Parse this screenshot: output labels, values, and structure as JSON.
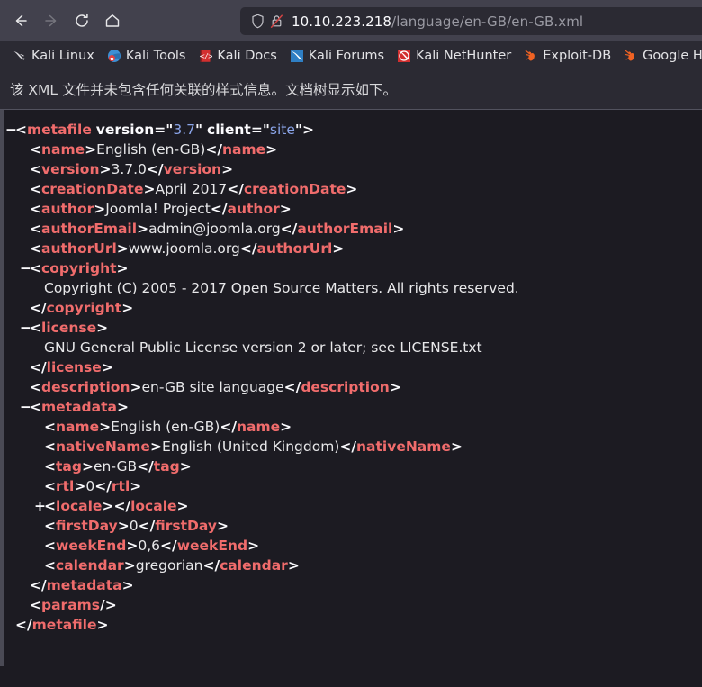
{
  "browser": {
    "nav": {
      "back": {
        "name": "back-button",
        "enabled": true,
        "title": "Back"
      },
      "forward": {
        "name": "forward-button",
        "enabled": false,
        "title": "Forward"
      },
      "reload": {
        "name": "reload-button",
        "enabled": true,
        "title": "Reload"
      },
      "home": {
        "name": "home-button",
        "enabled": true,
        "title": "Home"
      }
    },
    "urlbar": {
      "shield_icon": "shield-icon",
      "lock_icon": "lock-crossed-out-icon",
      "host": "10.10.223.218",
      "path": "/language/en-GB/en-GB.xml",
      "full_url": "10.10.223.218/language/en-GB/en-GB.xml"
    },
    "bookmarks": [
      {
        "label": "Kali Linux",
        "icon": "kali-dragon-icon"
      },
      {
        "label": "Kali Tools",
        "icon": "kali-tools-icon"
      },
      {
        "label": "Kali Docs",
        "icon": "kali-docs-book-icon"
      },
      {
        "label": "Kali Forums",
        "icon": "kali-forums-icon"
      },
      {
        "label": "Kali NetHunter",
        "icon": "kali-nethunter-icon"
      },
      {
        "label": "Exploit-DB",
        "icon": "exploit-db-icon"
      },
      {
        "label": "Google Hacking D",
        "icon": "google-hacking-db-icon"
      }
    ]
  },
  "notice": {
    "text": "该 XML 文件并未包含任何关联的样式信息。文档树显示如下。"
  },
  "colors": {
    "chrome_bg": "#42414d",
    "bookmark_bg": "#2b2a33",
    "page_bg": "#1c1b22",
    "tag": "#f06c6c",
    "attr_value": "#8aa4e8",
    "text": "#e8e8ea",
    "punctuation": "#fbfbfe"
  },
  "xml": {
    "lines": [
      {
        "twisty": "-",
        "indent": 0,
        "parts": [
          {
            "t": "punc",
            "v": "<"
          },
          {
            "t": "tag",
            "v": "metafile"
          },
          {
            "t": "txt",
            "v": " "
          },
          {
            "t": "attr",
            "v": "version"
          },
          {
            "t": "eq",
            "v": "="
          },
          {
            "t": "quote",
            "v": "\""
          },
          {
            "t": "val",
            "v": "3.7"
          },
          {
            "t": "quote",
            "v": "\""
          },
          {
            "t": "txt",
            "v": " "
          },
          {
            "t": "attr",
            "v": "client"
          },
          {
            "t": "eq",
            "v": "="
          },
          {
            "t": "quote",
            "v": "\""
          },
          {
            "t": "val",
            "v": "site"
          },
          {
            "t": "quote",
            "v": "\""
          },
          {
            "t": "punc",
            "v": ">"
          }
        ]
      },
      {
        "twisty": "",
        "indent": 1,
        "parts": [
          {
            "t": "punc",
            "v": "<"
          },
          {
            "t": "tag",
            "v": "name"
          },
          {
            "t": "punc",
            "v": ">"
          },
          {
            "t": "txt",
            "v": "English (en-GB)"
          },
          {
            "t": "punc",
            "v": "</"
          },
          {
            "t": "tag",
            "v": "name"
          },
          {
            "t": "punc",
            "v": ">"
          }
        ]
      },
      {
        "twisty": "",
        "indent": 1,
        "parts": [
          {
            "t": "punc",
            "v": "<"
          },
          {
            "t": "tag",
            "v": "version"
          },
          {
            "t": "punc",
            "v": ">"
          },
          {
            "t": "txt",
            "v": "3.7.0"
          },
          {
            "t": "punc",
            "v": "</"
          },
          {
            "t": "tag",
            "v": "version"
          },
          {
            "t": "punc",
            "v": ">"
          }
        ]
      },
      {
        "twisty": "",
        "indent": 1,
        "parts": [
          {
            "t": "punc",
            "v": "<"
          },
          {
            "t": "tag",
            "v": "creationDate"
          },
          {
            "t": "punc",
            "v": ">"
          },
          {
            "t": "txt",
            "v": "April 2017"
          },
          {
            "t": "punc",
            "v": "</"
          },
          {
            "t": "tag",
            "v": "creationDate"
          },
          {
            "t": "punc",
            "v": ">"
          }
        ]
      },
      {
        "twisty": "",
        "indent": 1,
        "parts": [
          {
            "t": "punc",
            "v": "<"
          },
          {
            "t": "tag",
            "v": "author"
          },
          {
            "t": "punc",
            "v": ">"
          },
          {
            "t": "txt",
            "v": "Joomla! Project"
          },
          {
            "t": "punc",
            "v": "</"
          },
          {
            "t": "tag",
            "v": "author"
          },
          {
            "t": "punc",
            "v": ">"
          }
        ]
      },
      {
        "twisty": "",
        "indent": 1,
        "parts": [
          {
            "t": "punc",
            "v": "<"
          },
          {
            "t": "tag",
            "v": "authorEmail"
          },
          {
            "t": "punc",
            "v": ">"
          },
          {
            "t": "txt",
            "v": "admin@joomla.org"
          },
          {
            "t": "punc",
            "v": "</"
          },
          {
            "t": "tag",
            "v": "authorEmail"
          },
          {
            "t": "punc",
            "v": ">"
          }
        ]
      },
      {
        "twisty": "",
        "indent": 1,
        "parts": [
          {
            "t": "punc",
            "v": "<"
          },
          {
            "t": "tag",
            "v": "authorUrl"
          },
          {
            "t": "punc",
            "v": ">"
          },
          {
            "t": "txt",
            "v": "www.joomla.org"
          },
          {
            "t": "punc",
            "v": "</"
          },
          {
            "t": "tag",
            "v": "authorUrl"
          },
          {
            "t": "punc",
            "v": ">"
          }
        ]
      },
      {
        "twisty": "-",
        "indent": 1,
        "parts": [
          {
            "t": "punc",
            "v": "<"
          },
          {
            "t": "tag",
            "v": "copyright"
          },
          {
            "t": "punc",
            "v": ">"
          }
        ]
      },
      {
        "twisty": "",
        "indent": 2,
        "parts": [
          {
            "t": "ctext",
            "v": "Copyright (C) 2005 - 2017 Open Source Matters. All rights reserved."
          }
        ]
      },
      {
        "twisty": "",
        "indent": 1,
        "parts": [
          {
            "t": "punc",
            "v": "</"
          },
          {
            "t": "tag",
            "v": "copyright"
          },
          {
            "t": "punc",
            "v": ">"
          }
        ]
      },
      {
        "twisty": "-",
        "indent": 1,
        "parts": [
          {
            "t": "punc",
            "v": "<"
          },
          {
            "t": "tag",
            "v": "license"
          },
          {
            "t": "punc",
            "v": ">"
          }
        ]
      },
      {
        "twisty": "",
        "indent": 2,
        "parts": [
          {
            "t": "ctext",
            "v": "GNU General Public License version 2 or later; see LICENSE.txt"
          }
        ]
      },
      {
        "twisty": "",
        "indent": 1,
        "parts": [
          {
            "t": "punc",
            "v": "</"
          },
          {
            "t": "tag",
            "v": "license"
          },
          {
            "t": "punc",
            "v": ">"
          }
        ]
      },
      {
        "twisty": "",
        "indent": 1,
        "parts": [
          {
            "t": "punc",
            "v": "<"
          },
          {
            "t": "tag",
            "v": "description"
          },
          {
            "t": "punc",
            "v": ">"
          },
          {
            "t": "txt",
            "v": "en-GB site language"
          },
          {
            "t": "punc",
            "v": "</"
          },
          {
            "t": "tag",
            "v": "description"
          },
          {
            "t": "punc",
            "v": ">"
          }
        ]
      },
      {
        "twisty": "-",
        "indent": 1,
        "parts": [
          {
            "t": "punc",
            "v": "<"
          },
          {
            "t": "tag",
            "v": "metadata"
          },
          {
            "t": "punc",
            "v": ">"
          }
        ]
      },
      {
        "twisty": "",
        "indent": 2,
        "parts": [
          {
            "t": "punc",
            "v": "<"
          },
          {
            "t": "tag",
            "v": "name"
          },
          {
            "t": "punc",
            "v": ">"
          },
          {
            "t": "txt",
            "v": "English (en-GB)"
          },
          {
            "t": "punc",
            "v": "</"
          },
          {
            "t": "tag",
            "v": "name"
          },
          {
            "t": "punc",
            "v": ">"
          }
        ]
      },
      {
        "twisty": "",
        "indent": 2,
        "parts": [
          {
            "t": "punc",
            "v": "<"
          },
          {
            "t": "tag",
            "v": "nativeName"
          },
          {
            "t": "punc",
            "v": ">"
          },
          {
            "t": "txt",
            "v": "English (United Kingdom)"
          },
          {
            "t": "punc",
            "v": "</"
          },
          {
            "t": "tag",
            "v": "nativeName"
          },
          {
            "t": "punc",
            "v": ">"
          }
        ]
      },
      {
        "twisty": "",
        "indent": 2,
        "parts": [
          {
            "t": "punc",
            "v": "<"
          },
          {
            "t": "tag",
            "v": "tag"
          },
          {
            "t": "punc",
            "v": ">"
          },
          {
            "t": "txt",
            "v": "en-GB"
          },
          {
            "t": "punc",
            "v": "</"
          },
          {
            "t": "tag",
            "v": "tag"
          },
          {
            "t": "punc",
            "v": ">"
          }
        ]
      },
      {
        "twisty": "",
        "indent": 2,
        "parts": [
          {
            "t": "punc",
            "v": "<"
          },
          {
            "t": "tag",
            "v": "rtl"
          },
          {
            "t": "punc",
            "v": ">"
          },
          {
            "t": "txt",
            "v": "0"
          },
          {
            "t": "punc",
            "v": "</"
          },
          {
            "t": "tag",
            "v": "rtl"
          },
          {
            "t": "punc",
            "v": ">"
          }
        ]
      },
      {
        "twisty": "+",
        "indent": 2,
        "parts": [
          {
            "t": "punc",
            "v": "<"
          },
          {
            "t": "tag",
            "v": "locale"
          },
          {
            "t": "punc",
            "v": ">"
          },
          {
            "t": "punc",
            "v": "</"
          },
          {
            "t": "tag",
            "v": "locale"
          },
          {
            "t": "punc",
            "v": ">"
          }
        ]
      },
      {
        "twisty": "",
        "indent": 2,
        "parts": [
          {
            "t": "punc",
            "v": "<"
          },
          {
            "t": "tag",
            "v": "firstDay"
          },
          {
            "t": "punc",
            "v": ">"
          },
          {
            "t": "txt",
            "v": "0"
          },
          {
            "t": "punc",
            "v": "</"
          },
          {
            "t": "tag",
            "v": "firstDay"
          },
          {
            "t": "punc",
            "v": ">"
          }
        ]
      },
      {
        "twisty": "",
        "indent": 2,
        "parts": [
          {
            "t": "punc",
            "v": "<"
          },
          {
            "t": "tag",
            "v": "weekEnd"
          },
          {
            "t": "punc",
            "v": ">"
          },
          {
            "t": "txt",
            "v": "0,6"
          },
          {
            "t": "punc",
            "v": "</"
          },
          {
            "t": "tag",
            "v": "weekEnd"
          },
          {
            "t": "punc",
            "v": ">"
          }
        ]
      },
      {
        "twisty": "",
        "indent": 2,
        "parts": [
          {
            "t": "punc",
            "v": "<"
          },
          {
            "t": "tag",
            "v": "calendar"
          },
          {
            "t": "punc",
            "v": ">"
          },
          {
            "t": "txt",
            "v": "gregorian"
          },
          {
            "t": "punc",
            "v": "</"
          },
          {
            "t": "tag",
            "v": "calendar"
          },
          {
            "t": "punc",
            "v": ">"
          }
        ]
      },
      {
        "twisty": "",
        "indent": 1,
        "parts": [
          {
            "t": "punc",
            "v": "</"
          },
          {
            "t": "tag",
            "v": "metadata"
          },
          {
            "t": "punc",
            "v": ">"
          }
        ]
      },
      {
        "twisty": "",
        "indent": 1,
        "parts": [
          {
            "t": "punc",
            "v": "<"
          },
          {
            "t": "tag",
            "v": "params"
          },
          {
            "t": "punc",
            "v": "/>"
          }
        ]
      },
      {
        "twisty": "",
        "indent": 0,
        "parts": [
          {
            "t": "punc",
            "v": "</"
          },
          {
            "t": "tag",
            "v": "metafile"
          },
          {
            "t": "punc",
            "v": ">"
          }
        ]
      }
    ]
  }
}
